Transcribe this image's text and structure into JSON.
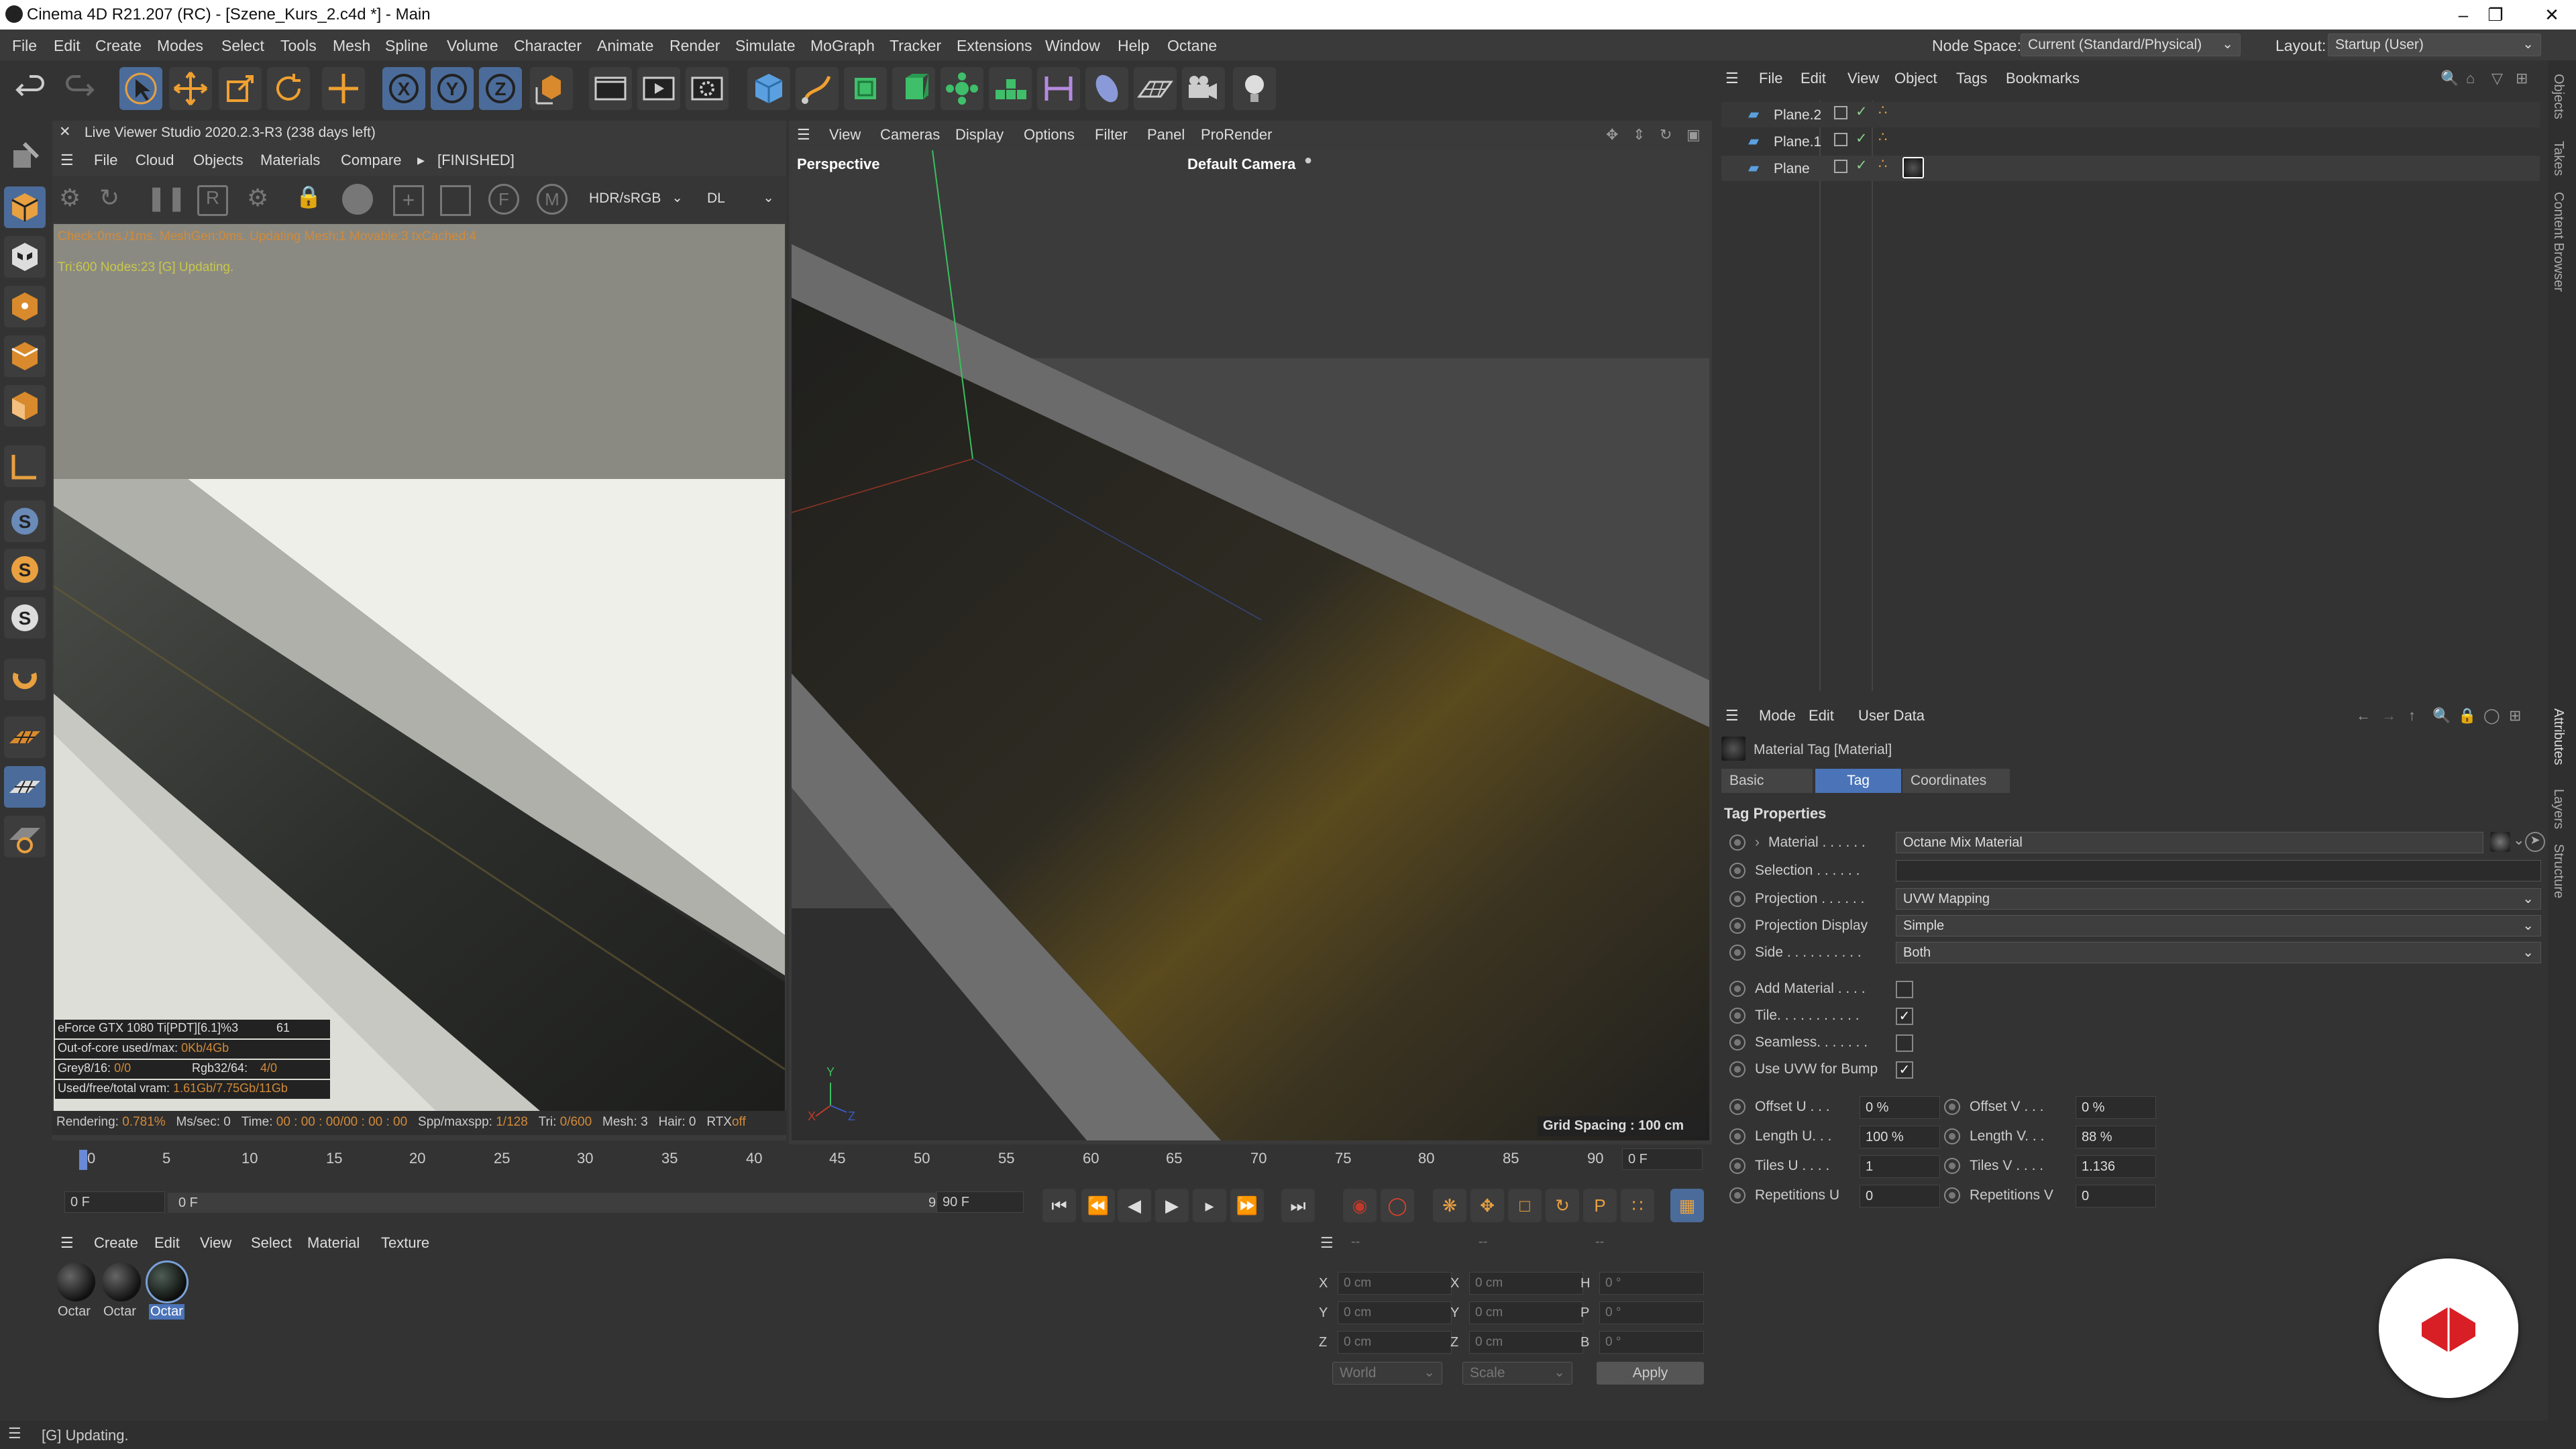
{
  "titlebar": {
    "title": "Cinema 4D R21.207 (RC) - [Szene_Kurs_2.c4d *] - Main"
  },
  "menubar": {
    "items": [
      "File",
      "Edit",
      "Create",
      "Modes",
      "Select",
      "Tools",
      "Mesh",
      "Spline",
      "Volume",
      "Character",
      "Animate",
      "Render",
      "Simulate",
      "MoGraph",
      "Tracker",
      "Extensions",
      "Window",
      "Help",
      "Octane"
    ],
    "node_space_label": "Node Space:",
    "node_space_value": "Current (Standard/Physical)",
    "layout_label": "Layout:",
    "layout_value": "Startup (User)"
  },
  "toolbar": {
    "x_label": "X",
    "y_label": "Y",
    "z_label": "Z",
    "icons": [
      "undo-icon",
      "redo-icon",
      "live-selection-icon",
      "move-icon",
      "scale-icon",
      "rotate-icon",
      "transform-icon",
      "x-axis-icon",
      "y-axis-icon",
      "z-axis-icon",
      "coordinate-system-icon",
      "render-view-icon",
      "render-picture-viewer-icon",
      "render-settings-icon",
      "cube-icon",
      "pen-icon",
      "subdivision-icon",
      "extrude-icon",
      "cloner-icon",
      "array-icon",
      "bend-icon",
      "sky-icon",
      "floor-icon",
      "camera-icon",
      "light-icon"
    ]
  },
  "live_viewer": {
    "title": "Live Viewer Studio 2020.2.3-R3 (238 days left)",
    "menu": [
      "File",
      "Cloud",
      "Objects",
      "Materials",
      "Compare"
    ],
    "status": "[FINISHED]",
    "hdr": "HDR/sRGB",
    "mode": "DL",
    "log_line1": "Check:0ms./1ms. MeshGen:0ms. Updating Mesh:1 Movable:3 txCached:4",
    "log_line2": "Tri:600 Nodes:23 [G] Updating.",
    "stats": {
      "gpu": "eForce GTX 1080 Ti[PDT][6.1]%3",
      "gpu_val": "61",
      "ooc_label": "Out-of-core used/max:",
      "ooc_val": "0Kb/4Gb",
      "grey_label": "Grey8/16:",
      "grey_val": "0/0",
      "rgb_label": "Rgb32/64:",
      "rgb_val": "4/0",
      "vram_label": "Used/free/total vram:",
      "vram_val": "1.61Gb/7.75Gb/11Gb"
    },
    "bottom": {
      "rendering_label": "Rendering:",
      "rendering": "0.781%",
      "ms_label": "Ms/sec:",
      "ms": "0",
      "time_label": "Time:",
      "time": "00 : 00 : 00/00 : 00 : 00",
      "spp_label": "Spp/maxspp:",
      "spp": "1/128",
      "tri_label": "Tri:",
      "tri": "0/600",
      "mesh_label": "Mesh:",
      "mesh": "3",
      "hair_label": "Hair:",
      "hair": "0",
      "rtx_label": "RTX",
      "rtx": "off"
    }
  },
  "viewport": {
    "menu": [
      "View",
      "Cameras",
      "Display",
      "Options",
      "Filter",
      "Panel",
      "ProRender"
    ],
    "view_name": "Perspective",
    "camera": "Default Camera",
    "grid_spacing": "Grid Spacing : 100 cm",
    "axis_y": "Y",
    "axis_x": "X",
    "axis_z": "Z"
  },
  "timeline": {
    "ticks": [
      "0",
      "5",
      "10",
      "15",
      "20",
      "25",
      "30",
      "35",
      "40",
      "45",
      "50",
      "55",
      "60",
      "65",
      "70",
      "75",
      "80",
      "85",
      "90"
    ],
    "current_frame": "0 F",
    "start_field": "0 F",
    "range_start": "0 F",
    "range_end": "90 F",
    "end_field": "90 F"
  },
  "material_manager": {
    "menu": [
      "Create",
      "Edit",
      "View",
      "Select",
      "Material",
      "Texture"
    ],
    "materials": [
      "Octar",
      "Octar",
      "Octar"
    ]
  },
  "coordinates": {
    "rows": [
      {
        "a": "X",
        "av": "0 cm",
        "b": "X",
        "bv": "0 cm",
        "c": "H",
        "cv": "0 °"
      },
      {
        "a": "Y",
        "av": "0 cm",
        "b": "Y",
        "bv": "0 cm",
        "c": "P",
        "cv": "0 °"
      },
      {
        "a": "Z",
        "av": "0 cm",
        "b": "Z",
        "bv": "0 cm",
        "c": "B",
        "cv": "0 °"
      }
    ],
    "world": "World",
    "scale": "Scale",
    "apply": "Apply",
    "dashes": [
      "--",
      "--",
      "--"
    ]
  },
  "objects": {
    "menu": [
      "File",
      "Edit",
      "View",
      "Object",
      "Tags",
      "Bookmarks"
    ],
    "items": [
      "Plane.2",
      "Plane.1",
      "Plane"
    ]
  },
  "attributes": {
    "menu": [
      "Mode",
      "Edit",
      "User Data"
    ],
    "header": "Material Tag [Material]",
    "tabs": [
      "Basic",
      "Tag",
      "Coordinates"
    ],
    "section": "Tag Properties",
    "material_label": "Material . . . . . .",
    "material_value": "Octane Mix Material",
    "selection_label": "Selection . . . . . .",
    "projection_label": "Projection . . . . . .",
    "projection_value": "UVW Mapping",
    "projection_display_label": "Projection Display",
    "projection_display_value": "Simple",
    "side_label": "Side . . . . . . . . . .",
    "side_value": "Both",
    "add_material_label": "Add Material . . . .",
    "add_material": false,
    "tile_label": "Tile. . . . . . . . . . .",
    "tile": true,
    "seamless_label": "Seamless. . . . . . .",
    "seamless": false,
    "uvw_bump_label": "Use UVW for Bump",
    "uvw_bump": true,
    "offset_u_label": "Offset U . . .",
    "offset_u": "0 %",
    "offset_v_label": "Offset V . . .",
    "offset_v": "0 %",
    "length_u_label": "Length U. . .",
    "length_u": "100 %",
    "length_v_label": "Length V. . .",
    "length_v": "88 %",
    "tiles_u_label": "Tiles U . . . .",
    "tiles_u": "1",
    "tiles_v_label": "Tiles V . . . .",
    "tiles_v": "1.136",
    "rep_u_label": "Repetitions U",
    "rep_u": "0",
    "rep_v_label": "Repetitions V",
    "rep_v": "0"
  },
  "statusbar": {
    "text": "[G] Updating."
  },
  "right_strip": {
    "top": [
      "Objects",
      "Takes",
      "Content Browser"
    ],
    "bottom": [
      "Attributes",
      "Layers",
      "Structure"
    ]
  },
  "colors": {
    "accent": "#4b74b8",
    "selected_tool": "#4b6c9a",
    "log_orange": "#d18a3a",
    "log_yellow": "#c8c84a",
    "brand_red": "#d81f26"
  }
}
